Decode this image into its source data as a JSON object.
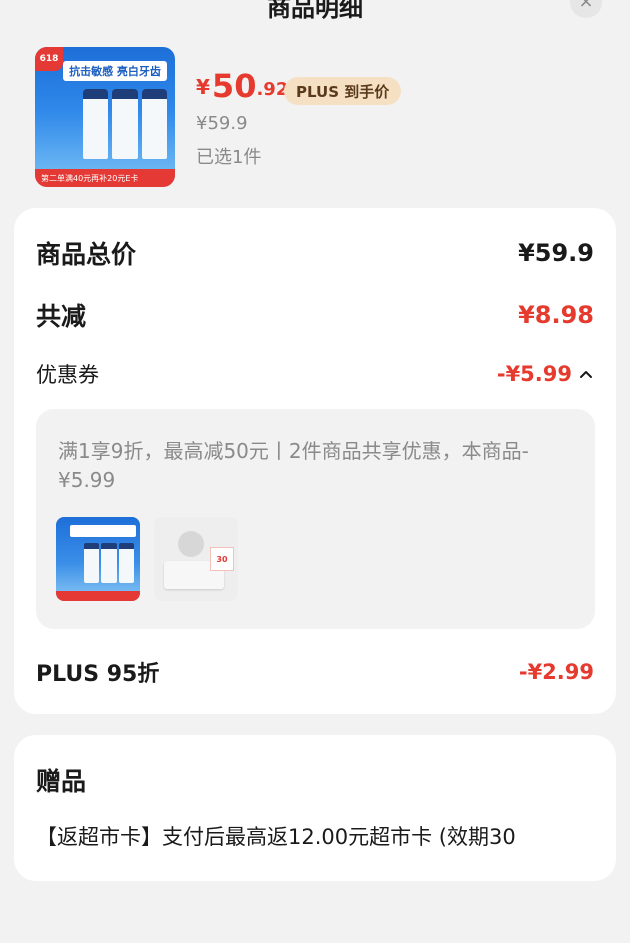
{
  "header": {
    "title": "商品明细",
    "close_icon": "×"
  },
  "product": {
    "thumb_618": "618",
    "thumb_banner": "抗击敏感 亮白牙齿",
    "thumb_footer": "第二单满40元再补20元E卡",
    "price_symbol": "¥",
    "price_int": "50",
    "price_dec": ".92",
    "plus_tag": "PLUS 到手价",
    "original_price": "¥59.9",
    "selected": "已选1件"
  },
  "summary": {
    "total_label": "商品总价",
    "total_value": "¥59.9",
    "discount_label": "共减",
    "discount_value": "¥8.98",
    "coupon_label": "优惠券",
    "coupon_value": "-¥5.99",
    "coupon_desc": "满1享9折，最高减50元丨2件商品共享优惠，本商品-¥5.99",
    "plus_label": "PLUS 95折",
    "plus_value": "-¥2.99"
  },
  "gift": {
    "title": "赠品",
    "text": "【返超市卡】支付后最高返12.00元超市卡 (效期30"
  },
  "colors": {
    "accent_red": "#e63a2e",
    "plus_tag_bg": "#f6e0c4",
    "page_bg": "#f2f2f2"
  }
}
